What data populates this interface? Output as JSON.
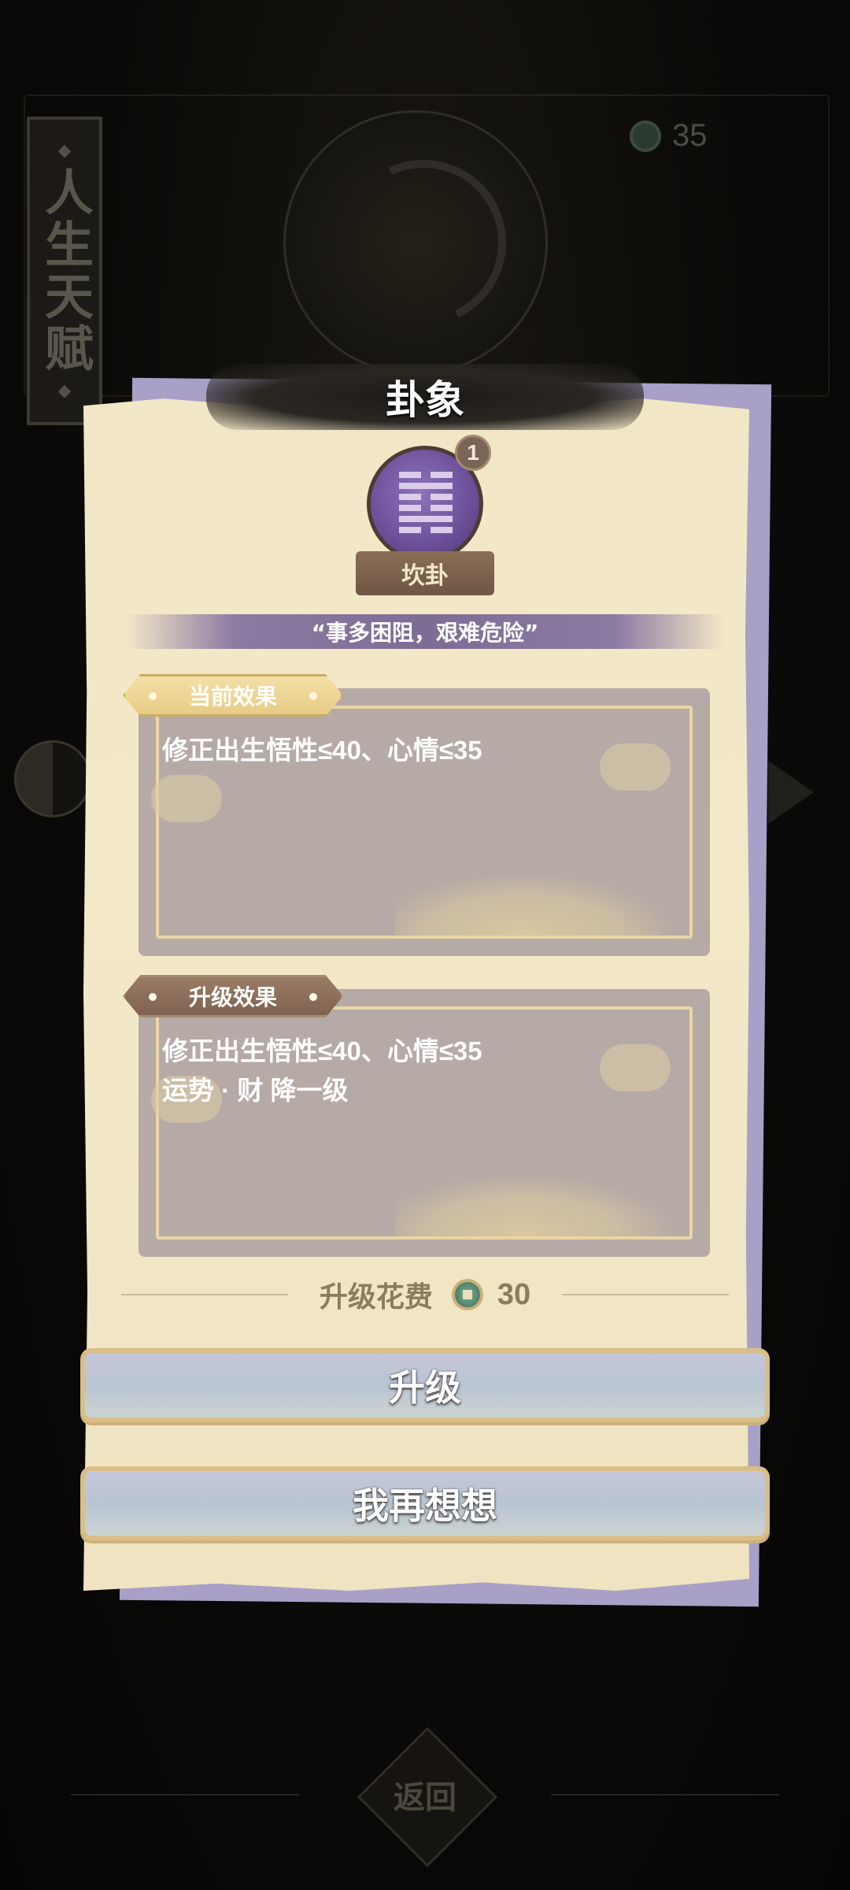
{
  "background": {
    "talent_banner": "人生天赋",
    "currency_value": "35",
    "return_label": "返回"
  },
  "dialog": {
    "title": "卦象",
    "hexagram": {
      "name": "坎卦",
      "level": "1",
      "quote": "“事多困阻，艰难危险”",
      "icon": "kan-hexagram-icon"
    },
    "current_effect": {
      "label": "当前效果",
      "lines": [
        "修正出生悟性≤40、心情≤35"
      ]
    },
    "upgrade_effect": {
      "label": "升级效果",
      "lines": [
        "修正出生悟性≤40、心情≤35",
        "运势 · 财 降一级"
      ]
    },
    "cost": {
      "label": "升级花费",
      "value": "30",
      "icon": "jade-coin-icon"
    },
    "buttons": {
      "upgrade": "升级",
      "reconsider": "我再想想"
    }
  },
  "colors": {
    "dialog_paper": "#f1e6c6",
    "dialog_shadow": "#a8a0c7",
    "hexagram_purple": "#6a4f98",
    "effect_box": "#b5aaa5",
    "cost_text": "#8a7c5c",
    "button_border": "#d9be86"
  }
}
